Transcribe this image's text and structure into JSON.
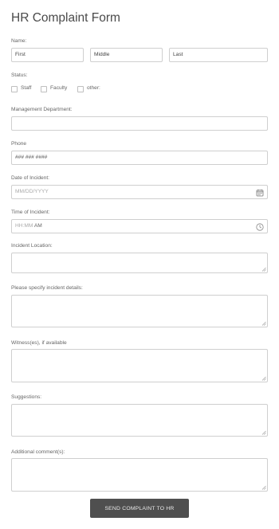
{
  "form": {
    "title": "HR Complaint Form",
    "name": {
      "label": "Name:",
      "first": "First",
      "middle": "Middle",
      "last": "Last"
    },
    "status": {
      "label": "Status:",
      "options": [
        "Staff",
        "Faculty",
        "other:"
      ]
    },
    "management_department": {
      "label": "Management Department:",
      "value": ""
    },
    "phone": {
      "label": "Phone",
      "value": "### ### ####"
    },
    "date_of_incident": {
      "label": "Date of Incident:",
      "placeholder": "MM/DD/YYYY",
      "icon": "calendar-icon"
    },
    "time_of_incident": {
      "label": "Time of Incident:",
      "placeholder": "HH:MM",
      "ampm": "AM",
      "icon": "clock-icon"
    },
    "incident_location": {
      "label": "Incident Location:"
    },
    "incident_details": {
      "label": "Please specify incident details:"
    },
    "witnesses": {
      "label": "Witness(es), if available"
    },
    "suggestions": {
      "label": "Suggestions:"
    },
    "additional_comments": {
      "label": "Additional comment(s):"
    },
    "submit_label": "SEND COMPLAINT TO HR"
  },
  "colors": {
    "button_bg": "#4f4f4f",
    "border": "#cfcfcf",
    "text": "#555555"
  }
}
